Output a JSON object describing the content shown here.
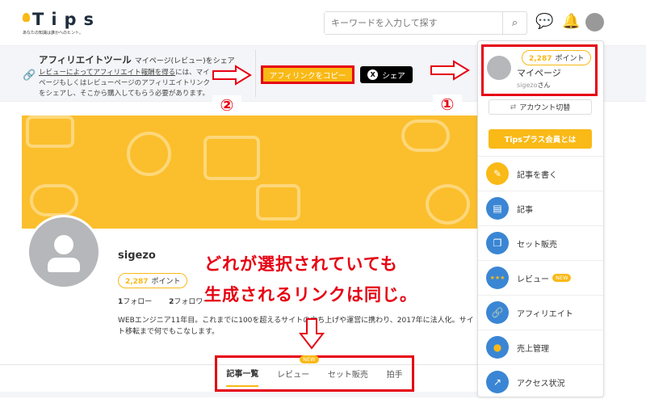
{
  "header": {
    "logo": "Tips",
    "tagline": "あなたの知識は誰かへのヒント。",
    "search_placeholder": "キーワードを入力して探す"
  },
  "affiliate": {
    "title": "アフィリエイトツール",
    "subtitle": "マイページ(レビュー)をシェア",
    "desc_link": "レビューによってアフィリエイト報酬を得る",
    "desc_rest": "には、マイページもしくはレビューページのアフィリエイトリンクをシェアし、そこから購入してもらう必要があります。",
    "copy_label": "アフィリンクをコピー",
    "share_label": "シェア",
    "share_icon": "X"
  },
  "annotations": {
    "num1": "①",
    "num2": "②",
    "line1": "どれが選択されていても",
    "line2": "生成されるリンクは同じ。"
  },
  "profile": {
    "name": "sigezo",
    "points": "2,287",
    "points_unit": "ポイント",
    "following": "1",
    "following_label": "フォロー",
    "followers": "2",
    "followers_label": "フォロワー",
    "bio": "WEBエンジニア11年目。これまでに100を超えるサイトの立ち上げや運営に携わり、2017年に法人化。サイト移転まで何でもこなします。"
  },
  "tabs": [
    {
      "label": "記事一覧",
      "active": true
    },
    {
      "label": "レビュー",
      "badge": "NEW"
    },
    {
      "label": "セット販売"
    },
    {
      "label": "拍手"
    }
  ],
  "menu": {
    "points": "2,287",
    "points_unit": "ポイント",
    "mypage": "マイページ",
    "user": "sigezo",
    "user_suffix": "さん",
    "switch_account": "アカウント切替",
    "plus": "Tipsプラス会員とは",
    "items": [
      {
        "label": "記事を書く",
        "color": "#f9b916"
      },
      {
        "label": "記事",
        "color": "#3a86d4"
      },
      {
        "label": "セット販売",
        "color": "#3a86d4"
      },
      {
        "label": "レビュー",
        "badge": "NEW",
        "color": "#3a86d4"
      },
      {
        "label": "アフィリエイト",
        "color": "#3a86d4"
      },
      {
        "label": "売上管理",
        "color": "#3a86d4"
      },
      {
        "label": "アクセス状況",
        "color": "#3a86d4"
      }
    ]
  },
  "colors": {
    "accent": "#f9b916",
    "annotation": "#e60012"
  }
}
